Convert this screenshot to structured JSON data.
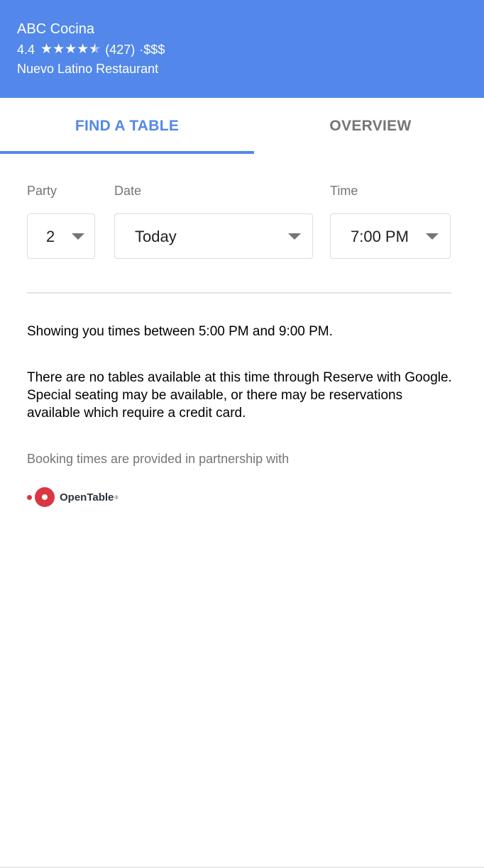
{
  "header": {
    "title": "ABC Cocina",
    "rating": "4.4",
    "stars_filled": 4,
    "stars_half": 1,
    "review_count": "(427)",
    "price": "·$$$",
    "category": "Nuevo Latino Restaurant",
    "background_color": "#5388ea"
  },
  "tabs": [
    {
      "label": "FIND A TABLE",
      "active": true
    },
    {
      "label": "OVERVIEW",
      "active": false
    }
  ],
  "form": {
    "party": {
      "label": "Party",
      "value": "2"
    },
    "date": {
      "label": "Date",
      "value": "Today"
    },
    "time": {
      "label": "Time",
      "value": "7:00 PM"
    }
  },
  "messages": {
    "range": "Showing you times between 5:00 PM and 9:00 PM.",
    "unavailable": "There are no tables available at this time through Reserve with Google. Special seating may be available, or there may be reservations available which require a credit card."
  },
  "partner": {
    "text": "Booking times are provided in partnership with",
    "logo_text": "OpenTable",
    "logo_mark": "®",
    "logo_color": "#da3743"
  },
  "icons": {
    "star": "star-icon",
    "dropdown": "chevron-down-icon",
    "logo": "opentable-logo-icon"
  }
}
